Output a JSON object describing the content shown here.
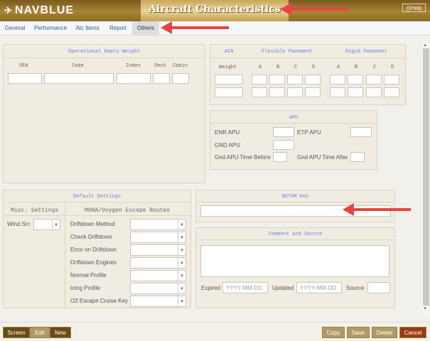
{
  "header": {
    "brand": "NAVBLUE",
    "title": "Aircraft Characteristics",
    "help": "Help"
  },
  "tabs": [
    "General",
    "Performance",
    "Atc Items",
    "Report",
    "Others"
  ],
  "operational_empty_weight": {
    "title": "Operational Empty Weight",
    "columns": [
      "OEW",
      "Code",
      "Index",
      "Deck",
      "Cabin"
    ]
  },
  "acn": {
    "title": "ACN",
    "flexible": "Flexible Pavement",
    "rigid": "Rigid Pavement",
    "weight": "Weight",
    "cols": [
      "A",
      "B",
      "C",
      "D"
    ]
  },
  "apu": {
    "title": "APU",
    "enr": "ENR APU",
    "etp": "ETP APU",
    "gnd": "GND APU",
    "before": "Gnd APU Time Before",
    "after": "Gnd APU Time After"
  },
  "default_settings": {
    "title": "Default Settings",
    "misc": "Misc. Settings",
    "mora": "MORA/Oxygen Escape Routes",
    "wind_src": "Wind Src",
    "rows": [
      "Driftdown Method",
      "Check Driftdown",
      "Error on Driftdown",
      "Driftdown Engines",
      "Normal Profile",
      "Icing Profile",
      "O2 Escape Cruise Key"
    ]
  },
  "notam": {
    "title": "NOTAM Key"
  },
  "comment": {
    "title": "Comment and Source",
    "expired": "Expired",
    "updated": "Updated",
    "source": "Source",
    "date_placeholder": "YYYY-MM-DD"
  },
  "footer": {
    "screen": "Screen",
    "edit": "Edit",
    "new": "New",
    "copy": "Copy",
    "save": "Save",
    "delete": "Delete",
    "cancel": "Cancel"
  }
}
